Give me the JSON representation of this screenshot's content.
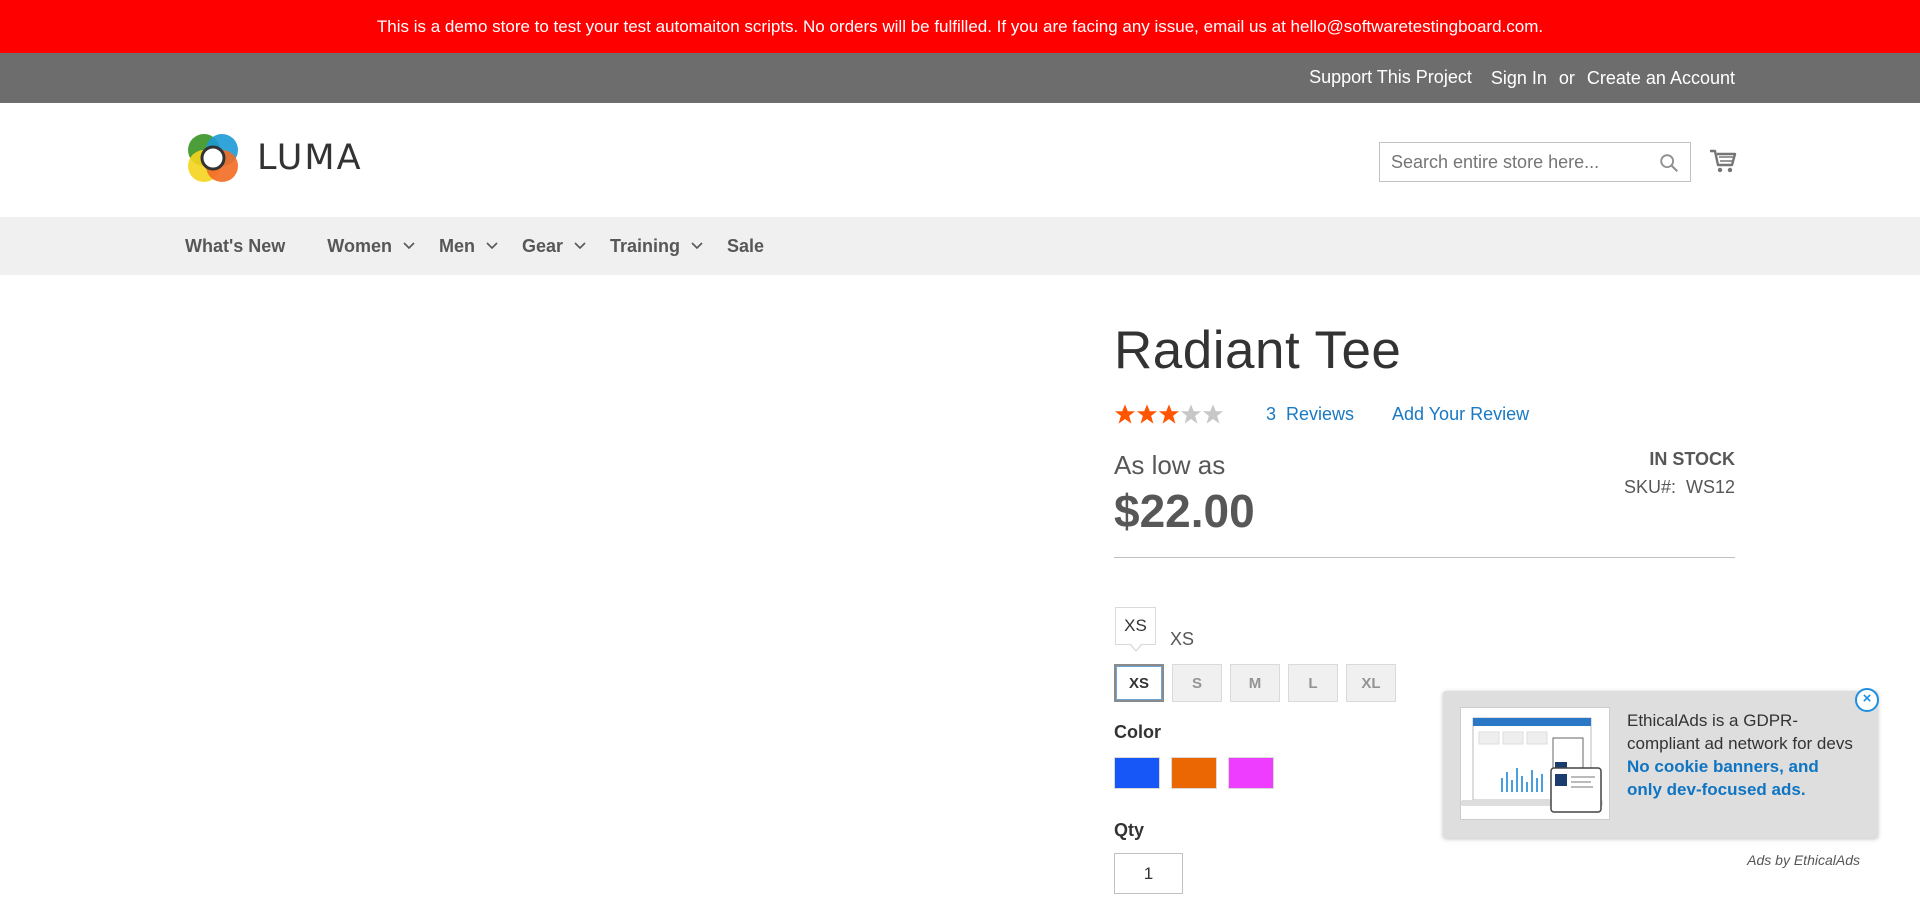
{
  "banner": {
    "text": "This is a demo store to test your test automaiton scripts. No orders will be fulfilled. If you are facing any issue, email us at hello@softwaretestingboard.com."
  },
  "panel": {
    "support": "Support This Project",
    "sign_in": "Sign In",
    "or": "or",
    "create_account": "Create an Account"
  },
  "header": {
    "logo_text": "LUMA",
    "search_placeholder": "Search entire store here...",
    "search_value": ""
  },
  "nav": {
    "items": [
      {
        "label": "What's New",
        "has_dropdown": false
      },
      {
        "label": "Women",
        "has_dropdown": true
      },
      {
        "label": "Men",
        "has_dropdown": true
      },
      {
        "label": "Gear",
        "has_dropdown": true
      },
      {
        "label": "Training",
        "has_dropdown": true
      },
      {
        "label": "Sale",
        "has_dropdown": false
      }
    ]
  },
  "product": {
    "title": "Radiant Tee",
    "rating_stars": 3,
    "rating_max": 5,
    "reviews_count": "3",
    "reviews_label": "Reviews",
    "add_review": "Add Your Review",
    "as_low_as": "As low as",
    "price": "$22.00",
    "stock": "IN STOCK",
    "sku_label": "SKU#:",
    "sku_value": "WS12",
    "size": {
      "tooltip": "XS",
      "selected_label": "XS",
      "options": [
        "XS",
        "S",
        "M",
        "L",
        "XL"
      ],
      "selected": "XS"
    },
    "color_label": "Color",
    "colors": [
      "#1857f7",
      "#eb6703",
      "#ef3dff"
    ],
    "qty_label": "Qty",
    "qty_value": "1"
  },
  "ad": {
    "text_plain": "EthicalAds is a GDPR-compliant ad network for devs",
    "text_highlight": "No cookie banners, and only dev-focused ads.",
    "by": "Ads by EthicalAds",
    "close": "×"
  },
  "colors": {
    "banner_bg": "#ff0000",
    "panel_bg": "#6d6d6d",
    "nav_bg": "#f0f0f0",
    "link": "#1979c3",
    "star_on": "#ff5501",
    "star_off": "#c7c7c7"
  }
}
